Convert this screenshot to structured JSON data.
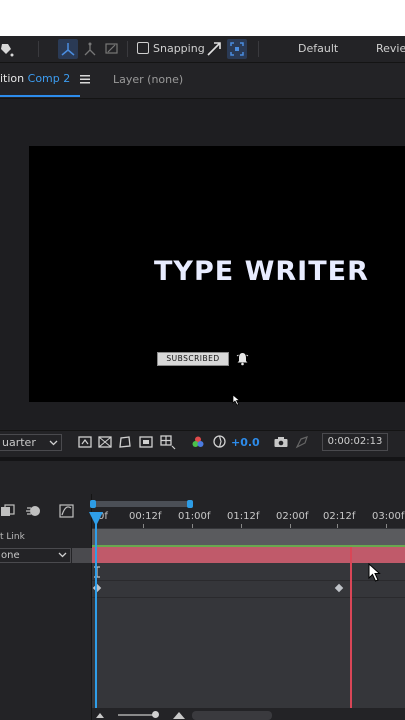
{
  "toolbar": {
    "snapping_label": "Snapping",
    "workspace_default": "Default",
    "workspace_review": "Review"
  },
  "panel_tabs": {
    "composition_prefix": "ition",
    "composition_name": "Comp 2",
    "layer_tab": "Layer (none)"
  },
  "composition": {
    "title_text": "TYPE WRITER",
    "subscribe_button": "SUBSCRIBED"
  },
  "viewer_controls": {
    "zoom_value": "uarter",
    "exposure": "+0.0",
    "timecode": "0:00:02:13"
  },
  "timeline": {
    "ruler_labels": [
      "0f",
      "00:12f",
      "01:00f",
      "01:12f",
      "02:00f",
      "02:12f",
      "03:00f"
    ],
    "parent_link_label": "t Link",
    "parent_value": "one"
  },
  "colors": {
    "accent_blue": "#2d8ceb",
    "playhead_blue": "#2f9ee8",
    "layer_bar_red": "#c05a6a",
    "current_time_red": "#d94657",
    "stage_black": "#000000"
  }
}
